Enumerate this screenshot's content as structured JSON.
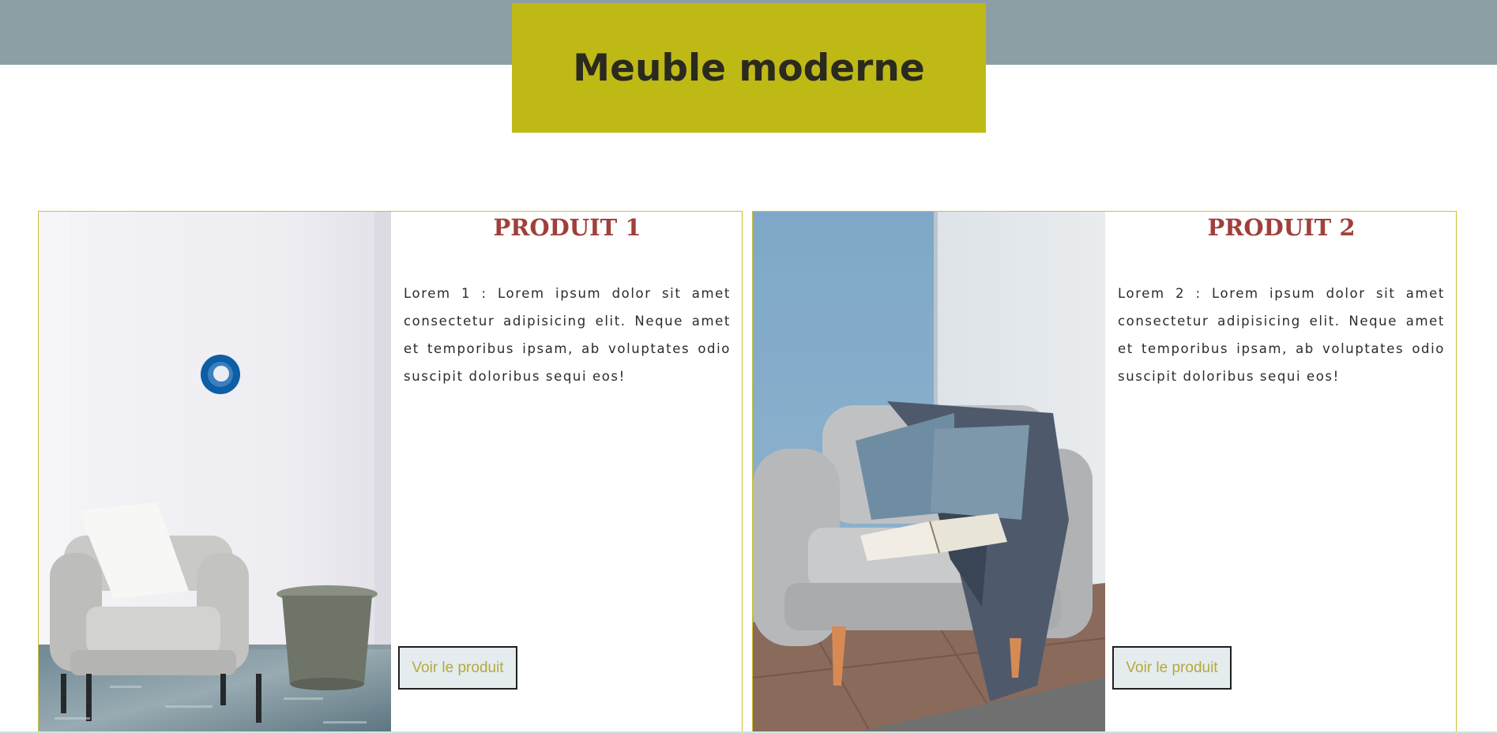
{
  "header": {
    "title": "Meuble moderne",
    "band_color": "#8e9ea5",
    "title_bg_color": "#bfb916"
  },
  "products": [
    {
      "title": "PRODUIT 1",
      "description": "Lorem 1 : Lorem ipsum dolor sit amet consectetur adipisicing elit. Neque amet et temporibus ipsam, ab voluptates odio suscipit doloribus sequi eos!",
      "button_label": "Voir le produit",
      "image": "armchair-white-room-photo"
    },
    {
      "title": "PRODUIT 2",
      "description": "Lorem 2 : Lorem ipsum dolor sit amet consectetur adipisicing elit. Neque amet et temporibus ipsam, ab voluptates odio suscipit doloribus sequi eos!",
      "button_label": "Voir le produit",
      "image": "armchair-blue-wall-photo"
    }
  ],
  "colors": {
    "accent": "#bfb916",
    "product_title": "#a0403b",
    "button_text": "#b4a93e",
    "button_bg": "#e5ecee"
  }
}
